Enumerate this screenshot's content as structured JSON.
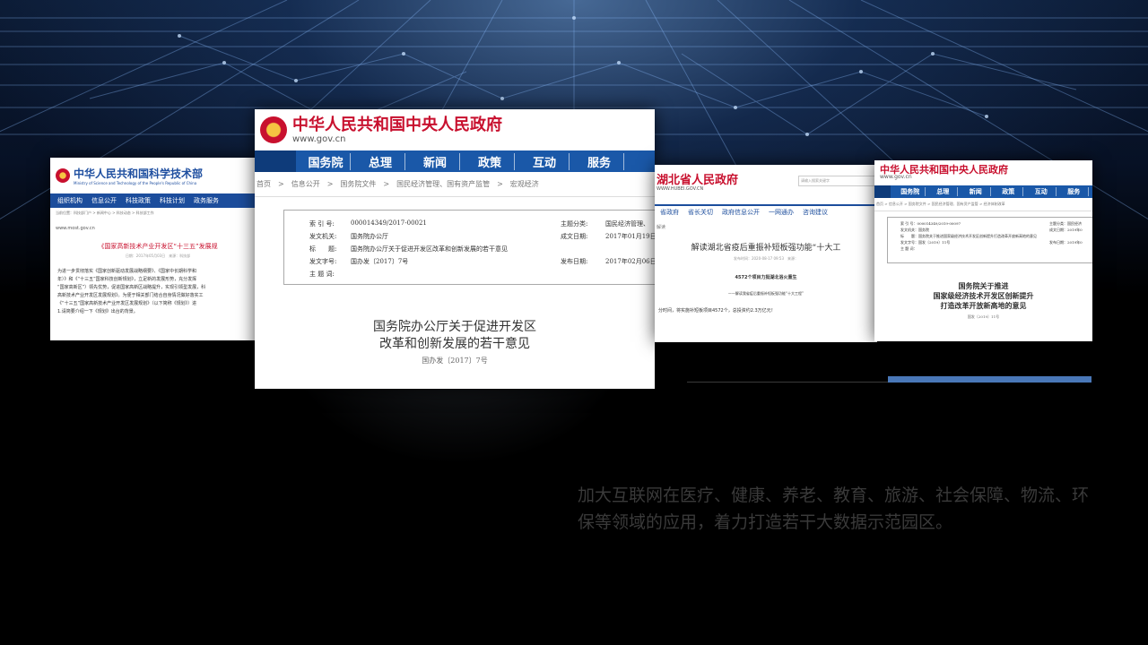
{
  "background": {
    "top_color": "#0b1a33",
    "glow": "#5b8fd8"
  },
  "shot1": {
    "title": "中华人民共和国科学技术部",
    "subtitle": "Ministry of Science and Technology of the People's Republic of China",
    "nav": [
      "组织机构",
      "信息公开",
      "科技政策",
      "科技计划",
      "政务服务"
    ],
    "crumb": "当前位置：科技部门户 > 新闻中心 > 科技动态 > 科技部工作",
    "url": "www.most.gov.cn",
    "article_title": "《国家高新技术产业开发区“十三五”发展规",
    "date": "日期：2017年05月03日　来源：科技部",
    "body": [
      "为进一步贯彻落实《国家创新驱动发展战略纲要》、《国家中长期科学和",
      "年）》和《“十三五”国家科技创新规划》，立足新的发展形势，充分发挥",
      "“国家高新区”）领先优势，促进国家高新区战略提升，实现引领型发展，科",
      "高新技术产业开发区发展规划》。为便于相关部门结合自身情况做好落实工",
      "《“十三五”国家高新技术产业开发区发展规划》（以下简称《规划》）进",
      "1.请简要介绍一下《规划》出台的背景。"
    ]
  },
  "shot2": {
    "title": "中华人民共和国中央人民政府",
    "site": "www.gov.cn",
    "nav": [
      "国务院",
      "总理",
      "新闻",
      "政策",
      "互动",
      "服务"
    ],
    "crumb": "首页　>　信息公开　>　国务院文件　>　国民经济管理、国有资产监管　>　宏观经济",
    "meta": {
      "index_label": "索 引 号:",
      "index_value": "000014349/2017-00021",
      "topic_label": "主题分类:",
      "topic_value": "国民经济管理、",
      "org_label": "发文机关:",
      "org_value": "国务院办公厅",
      "created_label": "成文日期:",
      "created_value": "2017年01月19日",
      "title_label": "标　　题:",
      "title_value": "国务院办公厅关于促进开发区改革和创新发展的若干意见",
      "doc_label": "发文字号:",
      "doc_value": "国办发〔2017〕7号",
      "pub_label": "发布日期:",
      "pub_value": "2017年02月06日",
      "subject_label": "主 题 词:"
    },
    "heading_line1": "国务院办公厅关于促进开发区",
    "heading_line2": "改革和创新发展的若干意见",
    "doc_number": "国办发〔2017〕7号"
  },
  "shot3": {
    "title": "湖北省人民政府",
    "site": "WWW.HUBEI.GOV.CN",
    "search_placeholder": "请输入搜索关键字",
    "nav": [
      "省政府",
      "省长关切",
      "政府信息公开",
      "一网通办",
      "咨询建议"
    ],
    "crumb": "解读",
    "article_title": "解读湖北省疫后重振补短板强功能“十大工",
    "meta": "发布时间：2020-08-17 09:53　来源：",
    "sub1": "4572个项目力挺湖北浴火重生",
    "sub2": "——解读我省疫后重振补短板强功能“十大工程”",
    "line": "分时间，将实施补短板项目4572个，总投资约2.3万亿元！"
  },
  "shot4": {
    "title": "中华人民共和国中央人民政府",
    "site": "www.gov.cn",
    "nav": [
      "国务院",
      "总理",
      "新闻",
      "政策",
      "互动",
      "服务"
    ],
    "crumb": "首页 > 信息公开 > 国务院文件 > 国民经济管理、国有资产监管 > 经济体制改革",
    "meta": {
      "index": "索 引 号：000014349/2019-00097",
      "topic": "主题分类：国民经济",
      "org": "发文机关：国务院",
      "created": "成文日期：2019年0",
      "title": "标　　题：国务院关于推进国家级经济技术开发区创新提升打造改革开放新高地的意见",
      "doc": "发文字号：国发〔2019〕11号",
      "pub": "发布日期：2019年0",
      "subject": "主 题 词："
    },
    "heading_line1": "国务院关于推进",
    "heading_line2": "国家级经济技术开发区创新提升",
    "heading_line3": "打造改革开放新高地的意见",
    "doc_number": "国发〔2019〕11号"
  },
  "caption": "加大互联网在医疗、健康、养老、教育、旅游、社会保障、物流、环保等领域的应用，着力打造若干大数据示范园区。",
  "accent_color": "#4a78b8"
}
